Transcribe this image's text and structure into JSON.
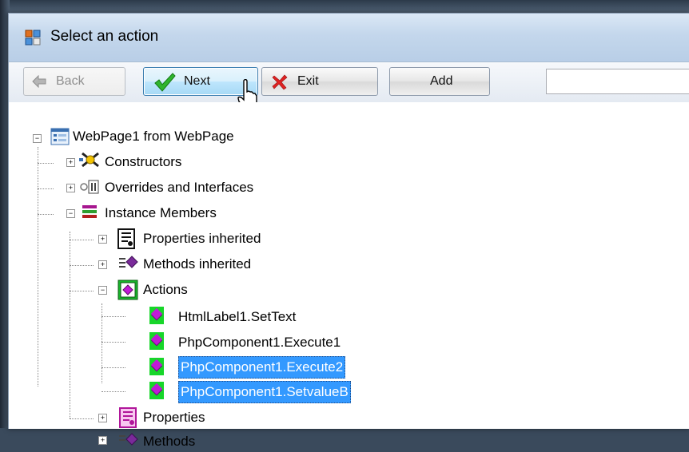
{
  "window": {
    "title": "Select an action"
  },
  "toolbar": {
    "back_label": "Back",
    "next_label": "Next",
    "exit_label": "Exit",
    "add_label": "Add",
    "search_value": ""
  },
  "tree": {
    "root": "WebPage1 from WebPage",
    "constructors": "Constructors",
    "overrides": "Overrides and Interfaces",
    "instance_members": "Instance Members",
    "properties_inherited": "Properties inherited",
    "methods_inherited": "Methods inherited",
    "actions": "Actions",
    "action_items": [
      {
        "label": "HtmlLabel1.SetText",
        "selected": false
      },
      {
        "label": "PhpComponent1.Execute1",
        "selected": false
      },
      {
        "label": "PhpComponent1.Execute2",
        "selected": true
      },
      {
        "label": "PhpComponent1.SetvalueB",
        "selected": true
      }
    ],
    "properties": "Properties",
    "methods": "Methods"
  },
  "colors": {
    "selection": "#3399ff",
    "action_icon_bg": "#17d62a",
    "action_icon_fg": "#c01ad6"
  },
  "icons": [
    "window-icon",
    "back-arrow-icon",
    "check-icon",
    "x-icon",
    "mouse-cursor-icon",
    "class-icon",
    "constructor-icon",
    "interface-icon",
    "members-icon",
    "properties-icon",
    "methods-icon",
    "actions-icon",
    "action-item-icon"
  ]
}
